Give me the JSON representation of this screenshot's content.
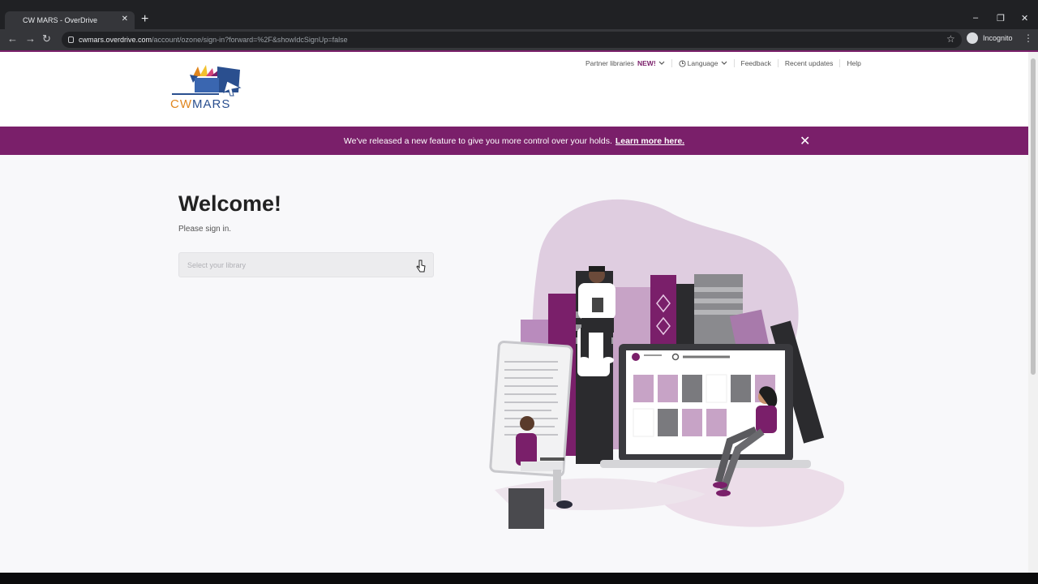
{
  "browser": {
    "tab_title": "CW MARS - OverDrive",
    "url_host": "cwmars.overdrive.com",
    "url_path": "/account/ozone/sign-in?forward=%2F&showIdcSignUp=false",
    "profile_label": "Incognito",
    "new_tab_symbol": "+",
    "tab_close_symbol": "✕",
    "back_symbol": "←",
    "forward_symbol": "→",
    "reload_symbol": "↻",
    "star_symbol": "☆",
    "menu_symbol": "⋮",
    "minimize_symbol": "–",
    "restore_symbol": "❐",
    "close_symbol": "✕"
  },
  "header": {
    "logo_part_a": "CW",
    "logo_part_b": "MARS",
    "nav": {
      "partner_libraries": "Partner libraries",
      "new_badge": "NEW!",
      "language": "Language",
      "feedback": "Feedback",
      "recent_updates": "Recent updates",
      "help": "Help"
    }
  },
  "banner": {
    "message": "We've released a new feature to give you more control over your holds.",
    "link": "Learn more here.",
    "close_symbol": "✕"
  },
  "signin": {
    "title": "Welcome!",
    "subtitle": "Please sign in.",
    "library_placeholder": "Select your library"
  },
  "colors": {
    "accent": "#7a1f6a",
    "logo_orange": "#e0861f",
    "logo_blue": "#2a4f8f"
  }
}
